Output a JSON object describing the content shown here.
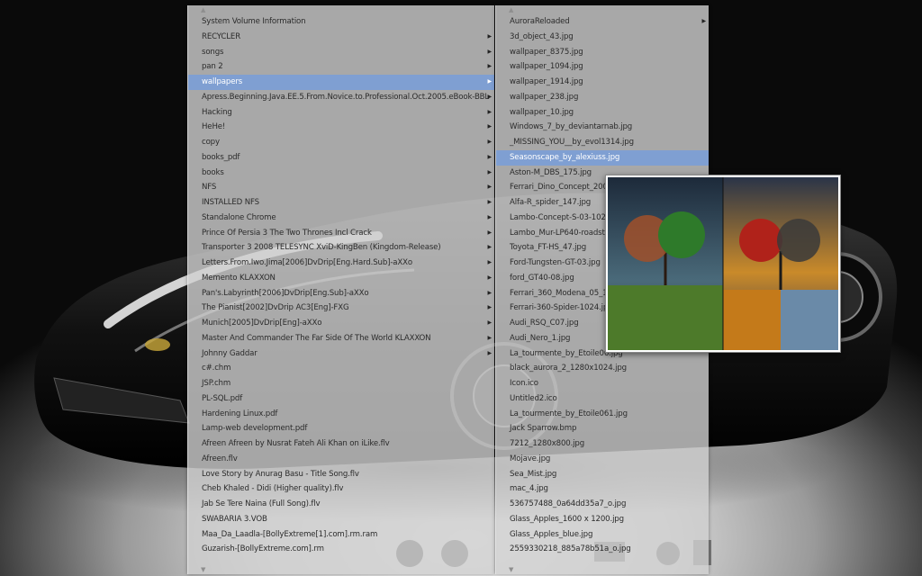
{
  "left_menu": {
    "items": [
      {
        "label": "System Volume Information",
        "submenu": false
      },
      {
        "label": "RECYCLER",
        "submenu": true
      },
      {
        "label": "songs",
        "submenu": true
      },
      {
        "label": "pan 2",
        "submenu": true
      },
      {
        "label": "wallpapers",
        "submenu": true,
        "selected": true
      },
      {
        "label": "Apress.Beginning.Java.EE.5.From.Novice.to.Professional.Oct.2005.eBook-BBL",
        "submenu": true
      },
      {
        "label": "Hacking",
        "submenu": true
      },
      {
        "label": "HeHe!",
        "submenu": true
      },
      {
        "label": "copy",
        "submenu": true
      },
      {
        "label": "books_pdf",
        "submenu": true
      },
      {
        "label": "books",
        "submenu": true
      },
      {
        "label": "NFS",
        "submenu": true
      },
      {
        "label": "INSTALLED NFS",
        "submenu": true
      },
      {
        "label": "Standalone Chrome",
        "submenu": true
      },
      {
        "label": "Prince Of Persia 3 The Two Thrones Incl Crack",
        "submenu": true
      },
      {
        "label": "Transporter 3 2008 TELESYNC XviD-KingBen (Kingdom-Release)",
        "submenu": true
      },
      {
        "label": "Letters.From.Iwo.Jima[2006]DvDrip[Eng.Hard.Sub]-aXXo",
        "submenu": true
      },
      {
        "label": "Memento KLAXXON",
        "submenu": true
      },
      {
        "label": "Pan's.Labyrinth[2006]DvDrip[Eng.Sub]-aXXo",
        "submenu": true
      },
      {
        "label": "The Pianist[2002]DvDrip AC3[Eng]-FXG",
        "submenu": true
      },
      {
        "label": "Munich[2005]DvDrip[Eng]-aXXo",
        "submenu": true
      },
      {
        "label": "Master And Commander The Far Side Of The World KLAXXON",
        "submenu": true
      },
      {
        "label": "Johnny Gaddar",
        "submenu": true
      },
      {
        "label": "c#.chm",
        "submenu": false
      },
      {
        "label": "JSP.chm",
        "submenu": false
      },
      {
        "label": "PL-SQL.pdf",
        "submenu": false
      },
      {
        "label": "Hardening Linux.pdf",
        "submenu": false
      },
      {
        "label": "Lamp-web development.pdf",
        "submenu": false
      },
      {
        "label": "Afreen Afreen by Nusrat Fateh Ali Khan on iLike.flv",
        "submenu": false
      },
      {
        "label": "Afreen.flv",
        "submenu": false
      },
      {
        "label": "Love Story by Anurag Basu - Title Song.flv",
        "submenu": false
      },
      {
        "label": "Cheb Khaled - Didi (Higher quality).flv",
        "submenu": false
      },
      {
        "label": "Jab Se Tere Naina (Full Song).flv",
        "submenu": false
      },
      {
        "label": "SWABARIA 3.VOB",
        "submenu": false
      },
      {
        "label": "Maa_Da_Laadla-[BollyExtreme[1].com].rm.ram",
        "submenu": false
      },
      {
        "label": "Guzarish-[BollyExtreme.com].rm",
        "submenu": false
      }
    ]
  },
  "right_menu": {
    "items": [
      {
        "label": "AuroraReloaded",
        "submenu": true
      },
      {
        "label": "3d_object_43.jpg"
      },
      {
        "label": "wallpaper_8375.jpg"
      },
      {
        "label": "wallpaper_1094.jpg"
      },
      {
        "label": "wallpaper_1914.jpg"
      },
      {
        "label": "wallpaper_238.jpg"
      },
      {
        "label": "wallpaper_10.jpg"
      },
      {
        "label": "Windows_7_by_deviantarnab.jpg"
      },
      {
        "label": "_MISSING_YOU__by_evol1314.jpg"
      },
      {
        "label": "Seasonscape_by_alexiuss.jpg",
        "selected": true
      },
      {
        "label": "Aston-M_DBS_175.jpg"
      },
      {
        "label": "Ferrari_Dino_Concept_2007"
      },
      {
        "label": "Alfa-R_spider_147.jpg"
      },
      {
        "label": "Lambo-Concept-S-03-1024."
      },
      {
        "label": "Lambo_Mur-LP640-roadster"
      },
      {
        "label": "Toyota_FT-HS_47.jpg"
      },
      {
        "label": "Ford-Tungsten-GT-03.jpg"
      },
      {
        "label": "ford_GT40-08.jpg"
      },
      {
        "label": "Ferrari_360_Modena_05_10"
      },
      {
        "label": "Ferrari-360-Spider-1024.jp"
      },
      {
        "label": "Audi_RSQ_C07.jpg"
      },
      {
        "label": "Audi_Nero_1.jpg"
      },
      {
        "label": "La_tourmente_by_Etoile06.jpg"
      },
      {
        "label": "black_aurora_2_1280x1024.jpg"
      },
      {
        "label": "Icon.ico"
      },
      {
        "label": "Untitled2.ico"
      },
      {
        "label": "La_tourmente_by_Etoile061.jpg"
      },
      {
        "label": "Jack Sparrow.bmp"
      },
      {
        "label": "7212_1280x800.jpg"
      },
      {
        "label": "Mojave.jpg"
      },
      {
        "label": "Sea_Mist.jpg"
      },
      {
        "label": "mac_4.jpg"
      },
      {
        "label": "536757488_0a64dd35a7_o.jpg"
      },
      {
        "label": "Glass_Apples_1600 x 1200.jpg"
      },
      {
        "label": "Glass_Apples_blue.jpg"
      },
      {
        "label": "2559330218_885a78b51a_o.jpg"
      }
    ]
  },
  "icons": {
    "scroll_up": "▲",
    "scroll_down": "▼",
    "submenu_arrow": "▶"
  }
}
